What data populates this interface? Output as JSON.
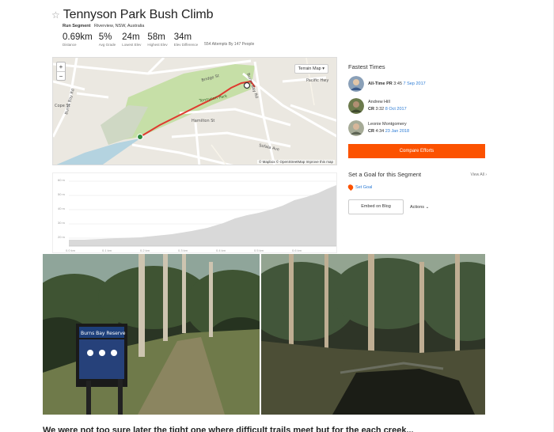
{
  "segment": {
    "title": "Tennyson Park Bush Climb",
    "label": "Run Segment",
    "location": "Riverview, NSW, Australia"
  },
  "stats": [
    {
      "value": "0.69km",
      "label": "Distance"
    },
    {
      "value": "5%",
      "label": "Avg Grade"
    },
    {
      "value": "24m",
      "label": "Lowest Elev"
    },
    {
      "value": "58m",
      "label": "Highest Elev"
    },
    {
      "value": "34m",
      "label": "Elev Difference"
    }
  ],
  "attempts": "554 Attempts By 147 People",
  "map": {
    "zoom_in": "+",
    "zoom_out": "−",
    "layer": "Terrain Map",
    "attribution": "© Mapbox © OpenStreetMap Improve this map",
    "labels": [
      "Bridge St",
      "Tennyson Park",
      "Burns Bay Rd",
      "Cope St",
      "Hamilton St",
      "Sofala Ave",
      "Burns Bay Rd",
      "Pacific Hwy"
    ]
  },
  "elevation": {
    "y_ticks": [
      "60 m",
      "50 m",
      "40 m",
      "30 m",
      "20 m"
    ],
    "x_ticks": [
      "0.0 km",
      "0.1 km",
      "0.2 km",
      "0.3 km",
      "0.4 km",
      "0.5 km",
      "0.6 km"
    ]
  },
  "fastest": {
    "title": "Fastest Times",
    "leaders": [
      {
        "badge": "All-Time PR",
        "time": "3:45",
        "date": "7 Sep 2017"
      },
      {
        "name": "Andrew Hill",
        "badge": "CR",
        "time": "3:32",
        "date": "8 Oct 2017"
      },
      {
        "name": "Leonie Montgomery",
        "badge": "CR",
        "time": "4:34",
        "date": "23 Jan 2018"
      }
    ],
    "compare": "Compare Efforts"
  },
  "goal": {
    "title": "Set a Goal for this Segment",
    "view_all": "View All",
    "set_goal": "Set Goal"
  },
  "buttons": {
    "embed": "Embed on Blog",
    "actions": "Actions"
  },
  "photos": {
    "sign_title": "Burns Bay Reserve"
  },
  "bottom_text": "We were not too sure later the tight one where difficult trails meet but for the each creek..."
}
